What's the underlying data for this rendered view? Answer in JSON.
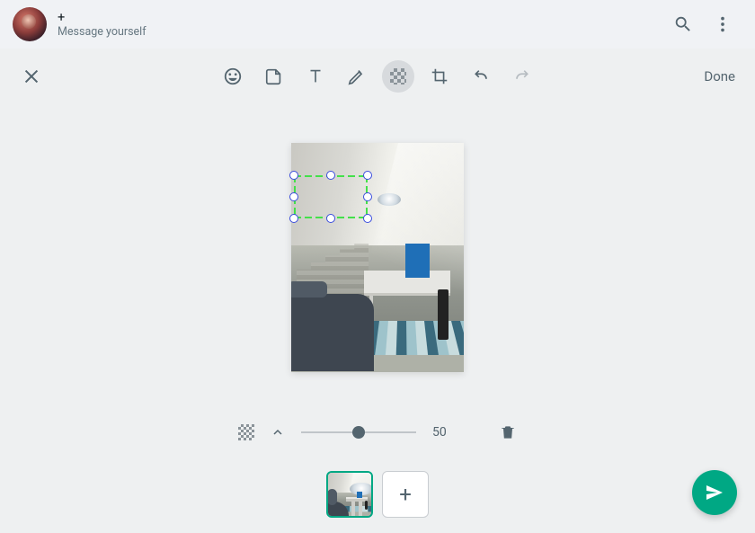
{
  "header": {
    "title": "+",
    "subtitle": "Message yourself"
  },
  "toolbar": {
    "done_label": "Done"
  },
  "editor": {
    "pixelation_value": "50",
    "slider_percent": 50
  },
  "thumbnails": {
    "add_label": "+"
  },
  "icons": {
    "search": "search-icon",
    "menu": "menu-icon",
    "close": "close-icon",
    "emoji": "emoji-icon",
    "sticker": "sticker-icon",
    "text": "text-icon",
    "draw": "draw-icon",
    "pixelate": "pixelate-icon",
    "crop": "crop-icon",
    "undo": "undo-icon",
    "redo": "redo-icon",
    "caret_up": "chevron-up-icon",
    "trash": "trash-icon",
    "send": "send-icon"
  }
}
